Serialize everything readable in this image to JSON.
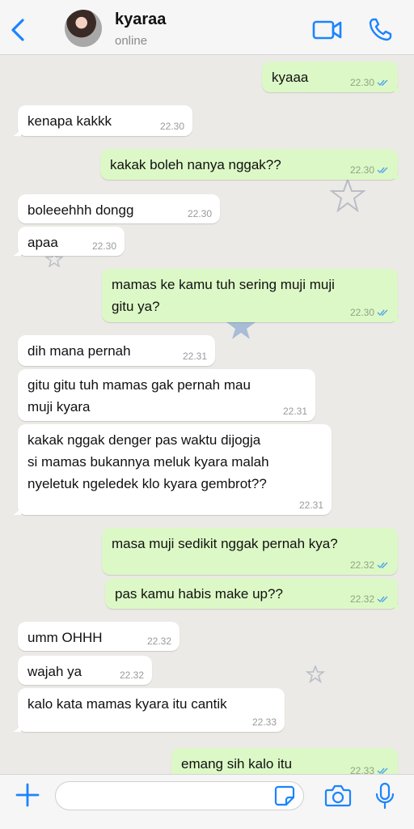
{
  "header": {
    "contact_name": "kyaraa",
    "status": "online"
  },
  "icons": {
    "back": "chevron-left-icon",
    "video": "video-camera-icon",
    "call": "phone-icon",
    "add": "plus-icon",
    "sticker": "sticker-icon",
    "camera": "camera-icon",
    "mic": "microphone-icon"
  },
  "colors": {
    "accent": "#1a84ff",
    "incoming_bubble": "#ffffff",
    "outgoing_bubble": "#dcf8c6",
    "read_tick": "#4fa6e8"
  },
  "messages": [
    {
      "dir": "out",
      "text": "kyaaa",
      "time": "22.30"
    },
    {
      "dir": "in",
      "text": "kenapa kakkk",
      "time": "22.30"
    },
    {
      "dir": "out",
      "text": "kakak boleh nanya nggak??",
      "time": "22.30"
    },
    {
      "dir": "in",
      "text": "boleeehhh dongg",
      "time": "22.30"
    },
    {
      "dir": "in",
      "text": "apaa",
      "time": "22.30"
    },
    {
      "dir": "out",
      "text": "mamas ke kamu tuh sering muji muji\ngitu ya?",
      "time": "22.30"
    },
    {
      "dir": "in",
      "text": "dih mana pernah",
      "time": "22.31"
    },
    {
      "dir": "in",
      "text": "gitu gitu tuh mamas gak pernah mau\nmuji kyara",
      "time": "22.31"
    },
    {
      "dir": "in",
      "text": "kakak nggak denger pas waktu dijogja\nsi mamas bukannya meluk kyara malah\nnyeletuk ngeledek klo kyara gembrot??",
      "time": "22.31"
    },
    {
      "dir": "out",
      "text": "masa muji sedikit nggak pernah kya?",
      "time": "22.32"
    },
    {
      "dir": "out",
      "text": "pas kamu habis make up??",
      "time": "22.32"
    },
    {
      "dir": "in",
      "text": "umm OHHH",
      "time": "22.32"
    },
    {
      "dir": "in",
      "text": "wajah ya",
      "time": "22.32"
    },
    {
      "dir": "in",
      "text": "kalo kata mamas kyara itu cantik",
      "time": "22.33"
    },
    {
      "dir": "out",
      "text": "emang sih kalo itu",
      "time": "22.33"
    }
  ],
  "composer": {
    "value": "",
    "placeholder": ""
  }
}
